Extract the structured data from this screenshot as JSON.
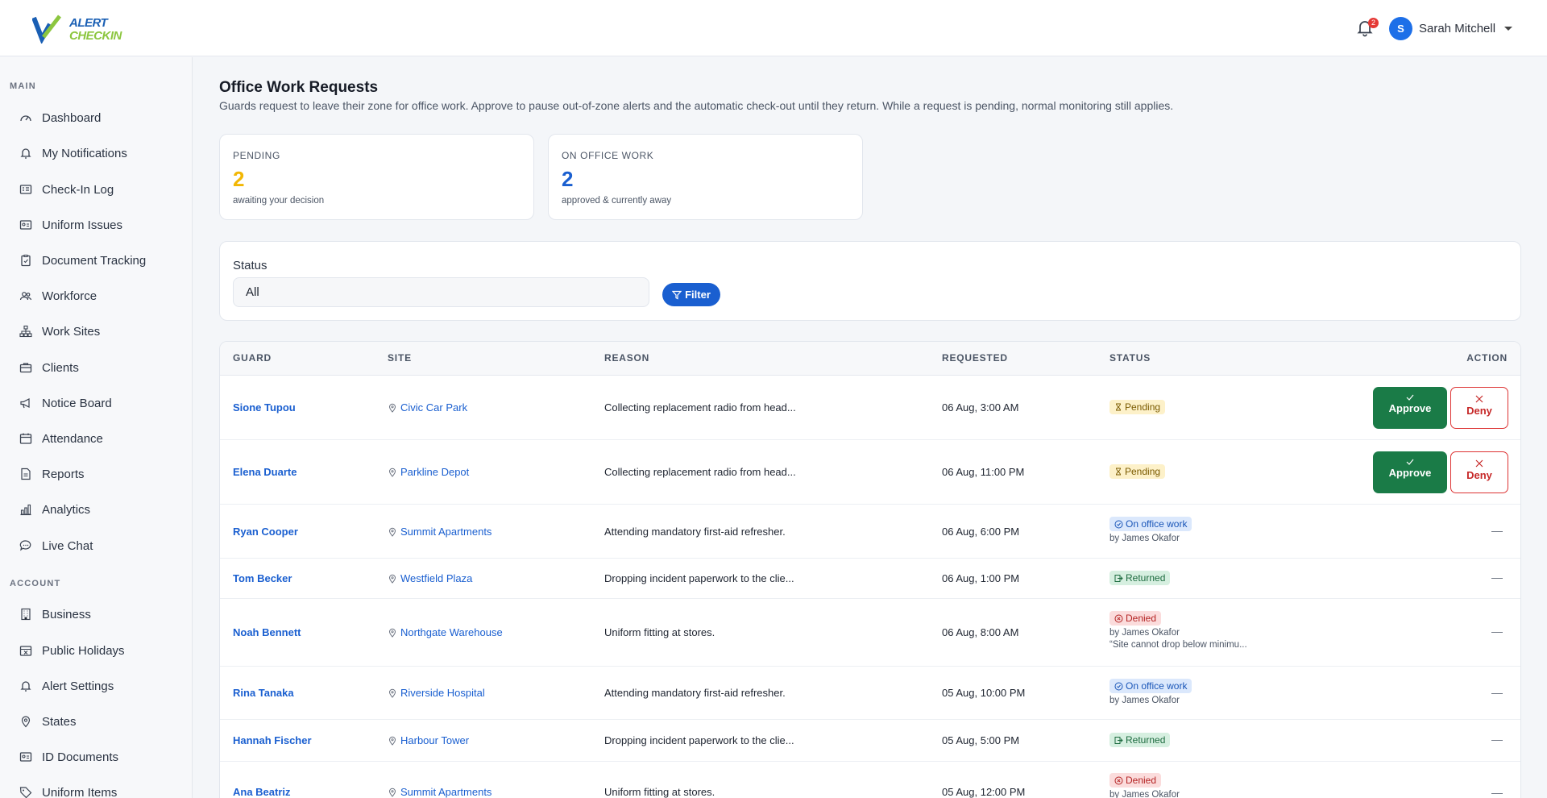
{
  "app": {
    "logo_top": "ALERT",
    "logo_bottom": "CHECKIN",
    "notification_count": "2",
    "user_initial": "S",
    "user_name": "Sarah Mitchell"
  },
  "sidebar": {
    "main_heading": "MAIN",
    "main_items": [
      {
        "label": "Dashboard",
        "icon": "gauge-icon"
      },
      {
        "label": "My Notifications",
        "icon": "bell-icon"
      },
      {
        "label": "Check-In Log",
        "icon": "list-icon"
      },
      {
        "label": "Uniform Issues",
        "icon": "id-card-icon"
      },
      {
        "label": "Document Tracking",
        "icon": "clipboard-icon"
      },
      {
        "label": "Workforce",
        "icon": "users-icon"
      },
      {
        "label": "Work Sites",
        "icon": "sitemap-icon"
      },
      {
        "label": "Clients",
        "icon": "briefcase-icon"
      },
      {
        "label": "Notice Board",
        "icon": "megaphone-icon"
      },
      {
        "label": "Attendance",
        "icon": "calendar-icon"
      },
      {
        "label": "Reports",
        "icon": "document-icon"
      },
      {
        "label": "Analytics",
        "icon": "bar-chart-icon"
      },
      {
        "label": "Live Chat",
        "icon": "chat-icon"
      }
    ],
    "account_heading": "ACCOUNT",
    "account_items": [
      {
        "label": "Business",
        "icon": "building-icon"
      },
      {
        "label": "Public Holidays",
        "icon": "calendar-x-icon"
      },
      {
        "label": "Alert Settings",
        "icon": "bell-icon"
      },
      {
        "label": "States",
        "icon": "map-pin-icon"
      },
      {
        "label": "ID Documents",
        "icon": "id-card-icon"
      },
      {
        "label": "Uniform Items",
        "icon": "tag-icon"
      }
    ]
  },
  "page": {
    "title": "Office Work Requests",
    "description": "Guards request to leave their zone for office work. Approve to pause out-of-zone alerts and the automatic check-out until they return. While a request is pending, normal monitoring still applies."
  },
  "stats": [
    {
      "label": "PENDING",
      "value": "2",
      "sub": "awaiting your decision",
      "color": "#f2b705"
    },
    {
      "label": "ON OFFICE WORK",
      "value": "2",
      "sub": "approved & currently away",
      "color": "#1a5fd0"
    }
  ],
  "filter": {
    "label": "Status",
    "selected": "All",
    "button": "Filter"
  },
  "table": {
    "headers": {
      "guard": "GUARD",
      "site": "SITE",
      "reason": "REASON",
      "requested": "REQUESTED",
      "status": "STATUS",
      "action": "ACTION"
    },
    "approve_label": "Approve",
    "deny_label": "Deny",
    "empty_action": "—",
    "rows": [
      {
        "guard": "Sione Tupou",
        "site": "Civic Car Park",
        "reason": "Collecting replacement radio from head...",
        "requested": "06 Aug, 3:00 AM",
        "status": "Pending",
        "by": "",
        "note": ""
      },
      {
        "guard": "Elena Duarte",
        "site": "Parkline Depot",
        "reason": "Collecting replacement radio from head...",
        "requested": "06 Aug, 11:00 PM",
        "status": "Pending",
        "by": "",
        "note": ""
      },
      {
        "guard": "Ryan Cooper",
        "site": "Summit Apartments",
        "reason": "Attending mandatory first-aid refresher.",
        "requested": "06 Aug, 6:00 PM",
        "status": "On office work",
        "by": "by James Okafor",
        "note": ""
      },
      {
        "guard": "Tom Becker",
        "site": "Westfield Plaza",
        "reason": "Dropping incident paperwork to the clie...",
        "requested": "06 Aug, 1:00 PM",
        "status": "Returned",
        "by": "",
        "note": ""
      },
      {
        "guard": "Noah Bennett",
        "site": "Northgate Warehouse",
        "reason": "Uniform fitting at stores.",
        "requested": "06 Aug, 8:00 AM",
        "status": "Denied",
        "by": "by James Okafor",
        "note": "“Site cannot drop below minimu..."
      },
      {
        "guard": "Rina Tanaka",
        "site": "Riverside Hospital",
        "reason": "Attending mandatory first-aid refresher.",
        "requested": "05 Aug, 10:00 PM",
        "status": "On office work",
        "by": "by James Okafor",
        "note": ""
      },
      {
        "guard": "Hannah Fischer",
        "site": "Harbour Tower",
        "reason": "Dropping incident paperwork to the clie...",
        "requested": "05 Aug, 5:00 PM",
        "status": "Returned",
        "by": "",
        "note": ""
      },
      {
        "guard": "Ana Beatriz",
        "site": "Summit Apartments",
        "reason": "Uniform fitting at stores.",
        "requested": "05 Aug, 12:00 PM",
        "status": "Denied",
        "by": "by James Okafor",
        "note": ""
      }
    ]
  }
}
